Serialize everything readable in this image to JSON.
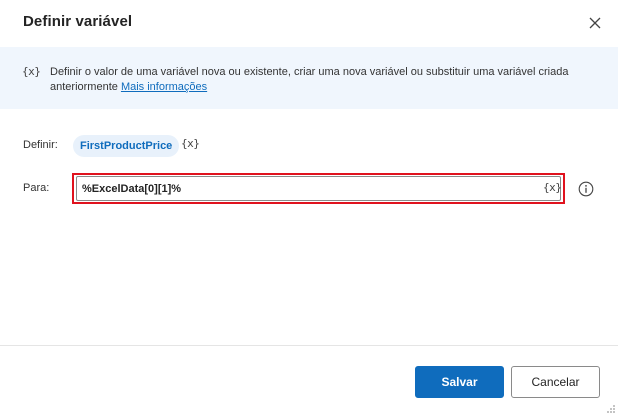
{
  "dialog": {
    "title": "Definir variável",
    "close_icon": "close-icon"
  },
  "info": {
    "icon_text": "{x}",
    "description": "Definir o valor de uma variável nova ou existente, criar uma nova variável ou substituir uma variável criada anteriormente",
    "link_label": "Mais informações"
  },
  "form": {
    "set_label": "Definir:",
    "variable_name": "FirstProductPrice",
    "variable_icon": "{x}",
    "to_label": "Para:",
    "to_value": "%ExcelData[0][1]%",
    "to_variable_icon": "{x}",
    "help_icon": "info-icon"
  },
  "footer": {
    "save_label": "Salvar",
    "cancel_label": "Cancelar"
  },
  "colors": {
    "accent": "#0f6cbd",
    "banner": "#f0f6fd",
    "highlight": "#e0121e"
  }
}
